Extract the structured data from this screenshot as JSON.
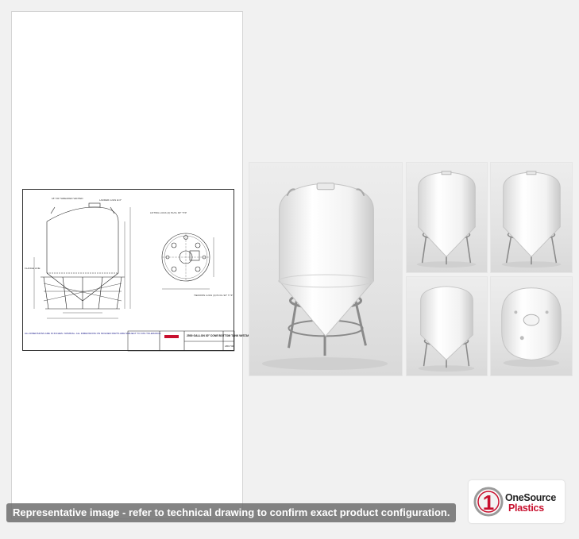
{
  "drawing": {
    "title_block": "2500 GALLON 30° CONE BOTTOM TANK W/STAND",
    "drawing_number": "ABC740",
    "callouts": {
      "threaded_vented": "18\" FR THREADED VENTED",
      "ladder_lugs": "LADDER LUGS ⊕ 0°",
      "flange_line": "FLANGE LINE",
      "lifting_lugs": "LIFTING LUGS (4) PL/CL 90° TYP",
      "tiedown_lugs": "TIEDOWN LUGS (4) PL/CL 90° TYP"
    },
    "notes": "ALL DIMENSIONS ARE IN INCHES. NOMINAL. ALL DIMENSIONS ON MOLDED PARTS ARE SUBJECT TO ±3% TOLERANCE."
  },
  "photos": [
    {
      "id": "main",
      "description_icon": "tank-front-view-icon"
    },
    {
      "id": "view-2",
      "description_icon": "tank-side-view-icon"
    },
    {
      "id": "view-3",
      "description_icon": "tank-side-view-icon"
    },
    {
      "id": "view-4",
      "description_icon": "tank-side-view-icon"
    },
    {
      "id": "view-5",
      "description_icon": "tank-top-view-icon"
    }
  ],
  "caption": "Representative image - refer to technical drawing to confirm exact product configuration.",
  "logo": {
    "numeral": "1",
    "line1": "OneSource",
    "line2": "Plastics",
    "brand_color": "#c8102e"
  }
}
